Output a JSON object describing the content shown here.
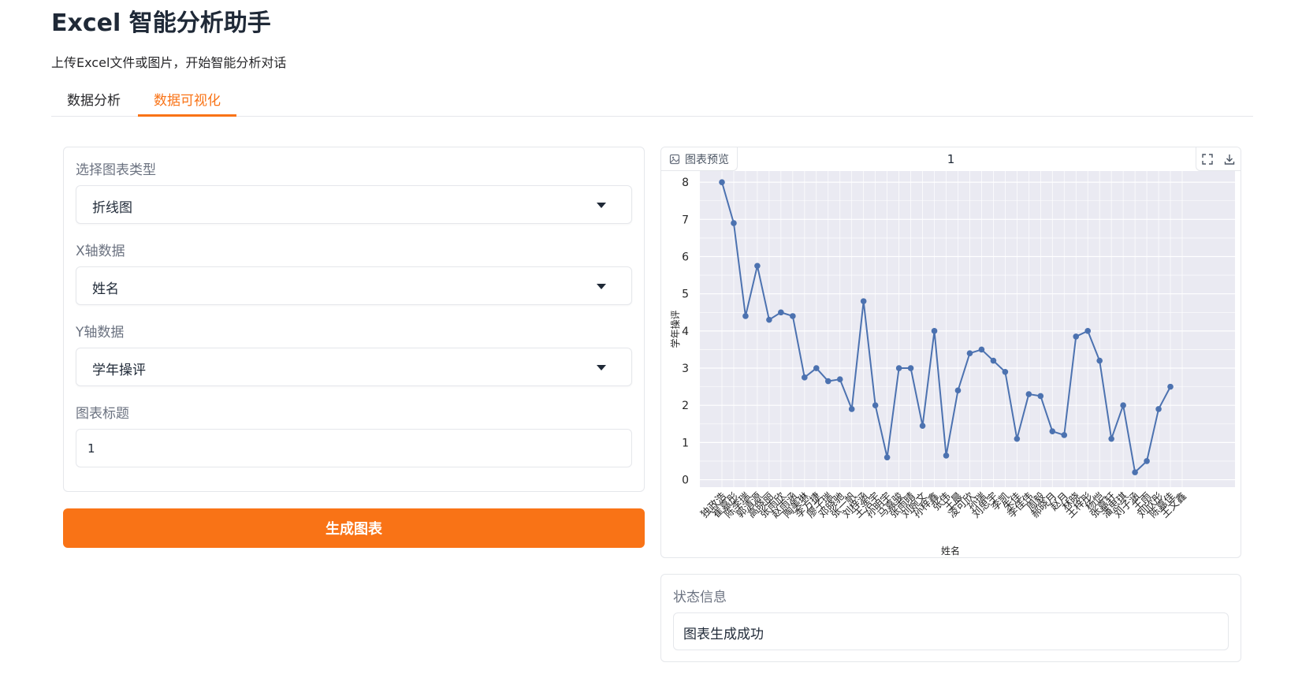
{
  "header": {
    "title": "Excel 智能分析助手",
    "subtitle": "上传Excel文件或图片，开始智能分析对话"
  },
  "tabs": [
    {
      "label": "数据分析",
      "active": false
    },
    {
      "label": "数据可视化",
      "active": true
    }
  ],
  "form": {
    "chart_type_label": "选择图表类型",
    "chart_type_value": "折线图",
    "x_label": "X轴数据",
    "x_value": "姓名",
    "y_label": "Y轴数据",
    "y_value": "学年操评",
    "title_label": "图表标题",
    "title_value": "1",
    "generate_label": "生成图表"
  },
  "preview": {
    "tag_label": "图表预览",
    "fullscreen_icon": "fullscreen-icon",
    "download_icon": "download-icon"
  },
  "status": {
    "label": "状态信息",
    "message": "图表生成成功"
  },
  "colors": {
    "accent": "#f97316",
    "line": "#4c72b0",
    "plot_bg": "#eaeaf2"
  },
  "chart_data": {
    "type": "line",
    "title": "1",
    "xlabel": "姓名",
    "ylabel": "学年操评",
    "ylim": [
      -0.2,
      8.3
    ],
    "yticks": [
      0,
      1,
      2,
      3,
      4,
      5,
      6,
      7,
      8
    ],
    "grid": true,
    "categories": [
      "独政浩",
      "崔嘉彤",
      "陈李瑞",
      "郭清源",
      "高晓丽",
      "张雨欣",
      "赵雨涵",
      "陶美琳",
      "李方捷",
      "廖子瑞",
      "邓晓驰",
      "张一帆",
      "刘梓涵",
      "王浩宇",
      "孙明宇",
      "马嘉骏",
      "张雨晴",
      "刘婉文",
      "孙梓鑫",
      "张伟",
      "王晨",
      "凌可欣",
      "孙瑞",
      "刘思宇",
      "李凯",
      "朱佳",
      "李佳伟",
      "周毅",
      "郝晓月",
      "赵月",
      "林晓",
      "王梓彤",
      "杨恺",
      "张嘉轩",
      "潘思琪",
      "刘子涵",
      "王雨",
      "刘欣彤",
      "陈嘉佳",
      "王文鑫"
    ],
    "values": [
      8.0,
      6.9,
      4.4,
      5.75,
      4.3,
      4.5,
      4.4,
      2.75,
      3.0,
      2.65,
      2.7,
      1.9,
      4.8,
      2.0,
      0.6,
      3.0,
      3.0,
      1.45,
      4.0,
      0.65,
      2.4,
      3.4,
      3.5,
      3.2,
      2.9,
      1.1,
      2.3,
      2.25,
      1.3,
      1.2,
      3.85,
      4.0,
      3.2,
      1.1,
      2.0,
      0.2,
      0.5,
      1.9,
      2.5
    ]
  }
}
